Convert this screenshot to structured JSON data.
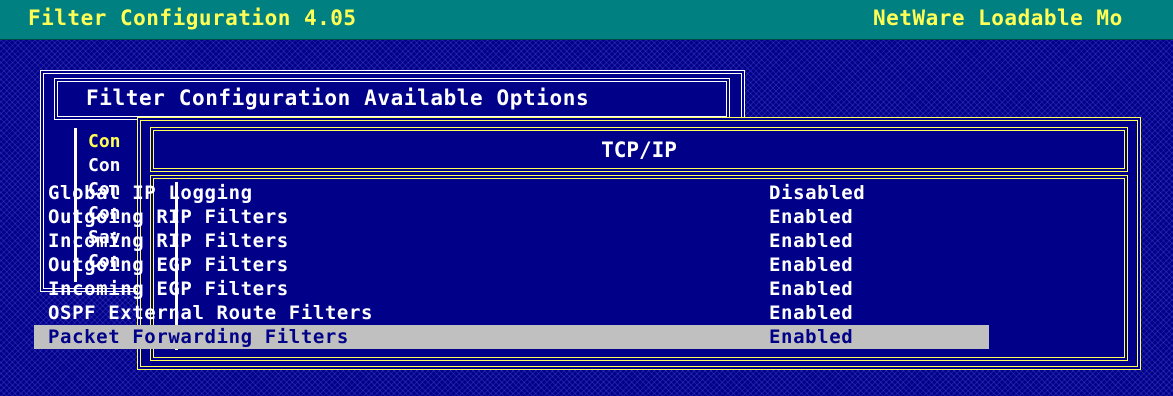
{
  "header": {
    "title": "Filter Configuration  4.05",
    "subtitle": "NetWare Loadable Mo"
  },
  "options_window": {
    "title": "Filter Configuration Available Options",
    "items": [
      {
        "label": "Con",
        "selected": true
      },
      {
        "label": "Con",
        "selected": false
      },
      {
        "label": "Con",
        "selected": false
      },
      {
        "label": "Con",
        "selected": false
      },
      {
        "label": "Sav",
        "selected": false
      },
      {
        "label": "Con",
        "selected": false
      }
    ]
  },
  "tcpip_window": {
    "title": "TCP/IP",
    "rows": [
      {
        "label": "Global IP Logging",
        "value": "Disabled"
      },
      {
        "label": "Outgoing RIP Filters",
        "value": "Enabled"
      },
      {
        "label": "Incoming RIP Filters",
        "value": "Enabled"
      },
      {
        "label": "Outgoing EGP Filters",
        "value": "Enabled"
      },
      {
        "label": "Incoming EGP Filters",
        "value": "Enabled"
      },
      {
        "label": "OSPF External Route Filters",
        "value": "Enabled"
      },
      {
        "label": "Packet Forwarding Filters",
        "value": "Enabled"
      }
    ],
    "selected_row": "Packet Forwarding Filters"
  },
  "colors": {
    "background": "#000088",
    "header": "#008080",
    "header_text": "#ffff55",
    "highlight": "#c0c0c0",
    "frame_front": "#ffff55",
    "frame_back": "#ffffff"
  }
}
